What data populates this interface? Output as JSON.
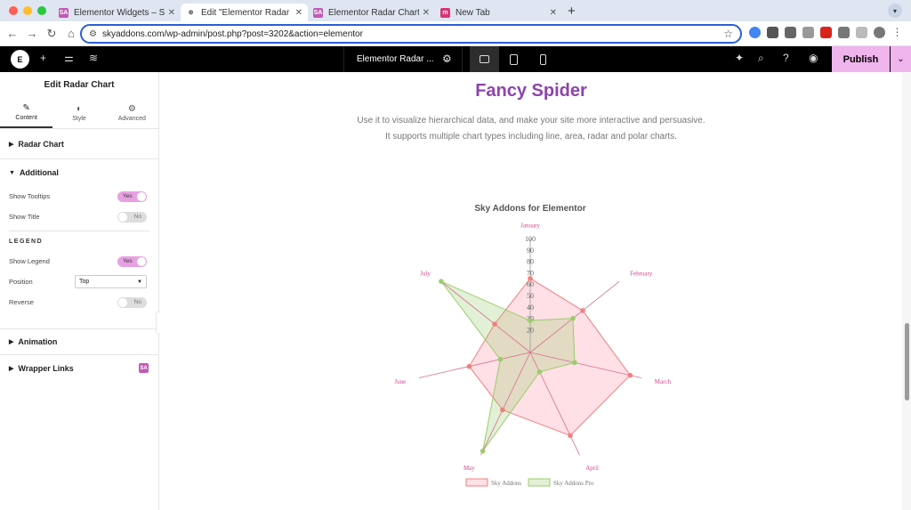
{
  "browser": {
    "tabs": [
      {
        "title": "Elementor Widgets – Sky Addons",
        "fav": "SA",
        "fav_color": "#c15ab5"
      },
      {
        "title": "Edit \"Elementor Radar Chart\"",
        "fav": "⊕",
        "fav_color": "#555555"
      },
      {
        "title": "Elementor Radar Chart Widget",
        "fav": "SA",
        "fav_color": "#c15ab5"
      },
      {
        "title": "New Tab",
        "fav": "m",
        "fav_color": "#d83474"
      }
    ],
    "url": "skyaddons.com/wp-admin/post.php?post=3202&action=elementor"
  },
  "editor": {
    "doc_name": "Elementor Radar ...",
    "publish_label": "Publish"
  },
  "panel": {
    "title": "Edit Radar Chart",
    "tabs": [
      {
        "label": "Content",
        "icon": "pencil-icon"
      },
      {
        "label": "Style",
        "icon": "half-circle-icon"
      },
      {
        "label": "Advanced",
        "icon": "gear-icon"
      }
    ],
    "sections": {
      "radar_chart": "Radar Chart",
      "additional": "Additional",
      "animation": "Animation",
      "wrapper_links": "Wrapper Links"
    },
    "controls": {
      "show_tooltips": {
        "label": "Show Tooltips",
        "state": "Yes"
      },
      "show_title": {
        "label": "Show Title",
        "state": "No"
      },
      "legend_heading": "LEGEND",
      "show_legend": {
        "label": "Show Legend",
        "state": "Yes"
      },
      "position": {
        "label": "Position",
        "value": "Top"
      },
      "reverse": {
        "label": "Reverse",
        "state": "No"
      }
    }
  },
  "page": {
    "heading": "Fancy Spider",
    "desc_line1": "Use it to visualize hierarchical data, and make your site more interactive and persuasive.",
    "desc_line2": "It supports multiple chart types including line, area, radar and polar charts."
  },
  "chart_data": {
    "type": "radar",
    "title": "Sky Addons for Elementor",
    "categories": [
      "January",
      "February",
      "March",
      "April",
      "May",
      "June",
      "July"
    ],
    "rmax": 100,
    "ticks": [
      10,
      20,
      30,
      40,
      50,
      60,
      70,
      80,
      90,
      100
    ],
    "tick_labels": [
      "",
      "20",
      "30",
      "40",
      "50",
      "60",
      "70",
      "80",
      "90",
      "100"
    ],
    "legend_position": "bottom",
    "series": [
      {
        "name": "Sky Addons",
        "values": [
          65,
          59,
          90,
          81,
          56,
          55,
          40
        ],
        "color": "#f08080",
        "fill": "rgba(255,99,132,0.2)"
      },
      {
        "name": "Sky Addons Pro",
        "values": [
          28,
          48,
          40,
          19,
          96,
          27,
          100
        ],
        "color": "#9acd6a",
        "fill": "rgba(140,200,90,0.25)"
      }
    ]
  }
}
